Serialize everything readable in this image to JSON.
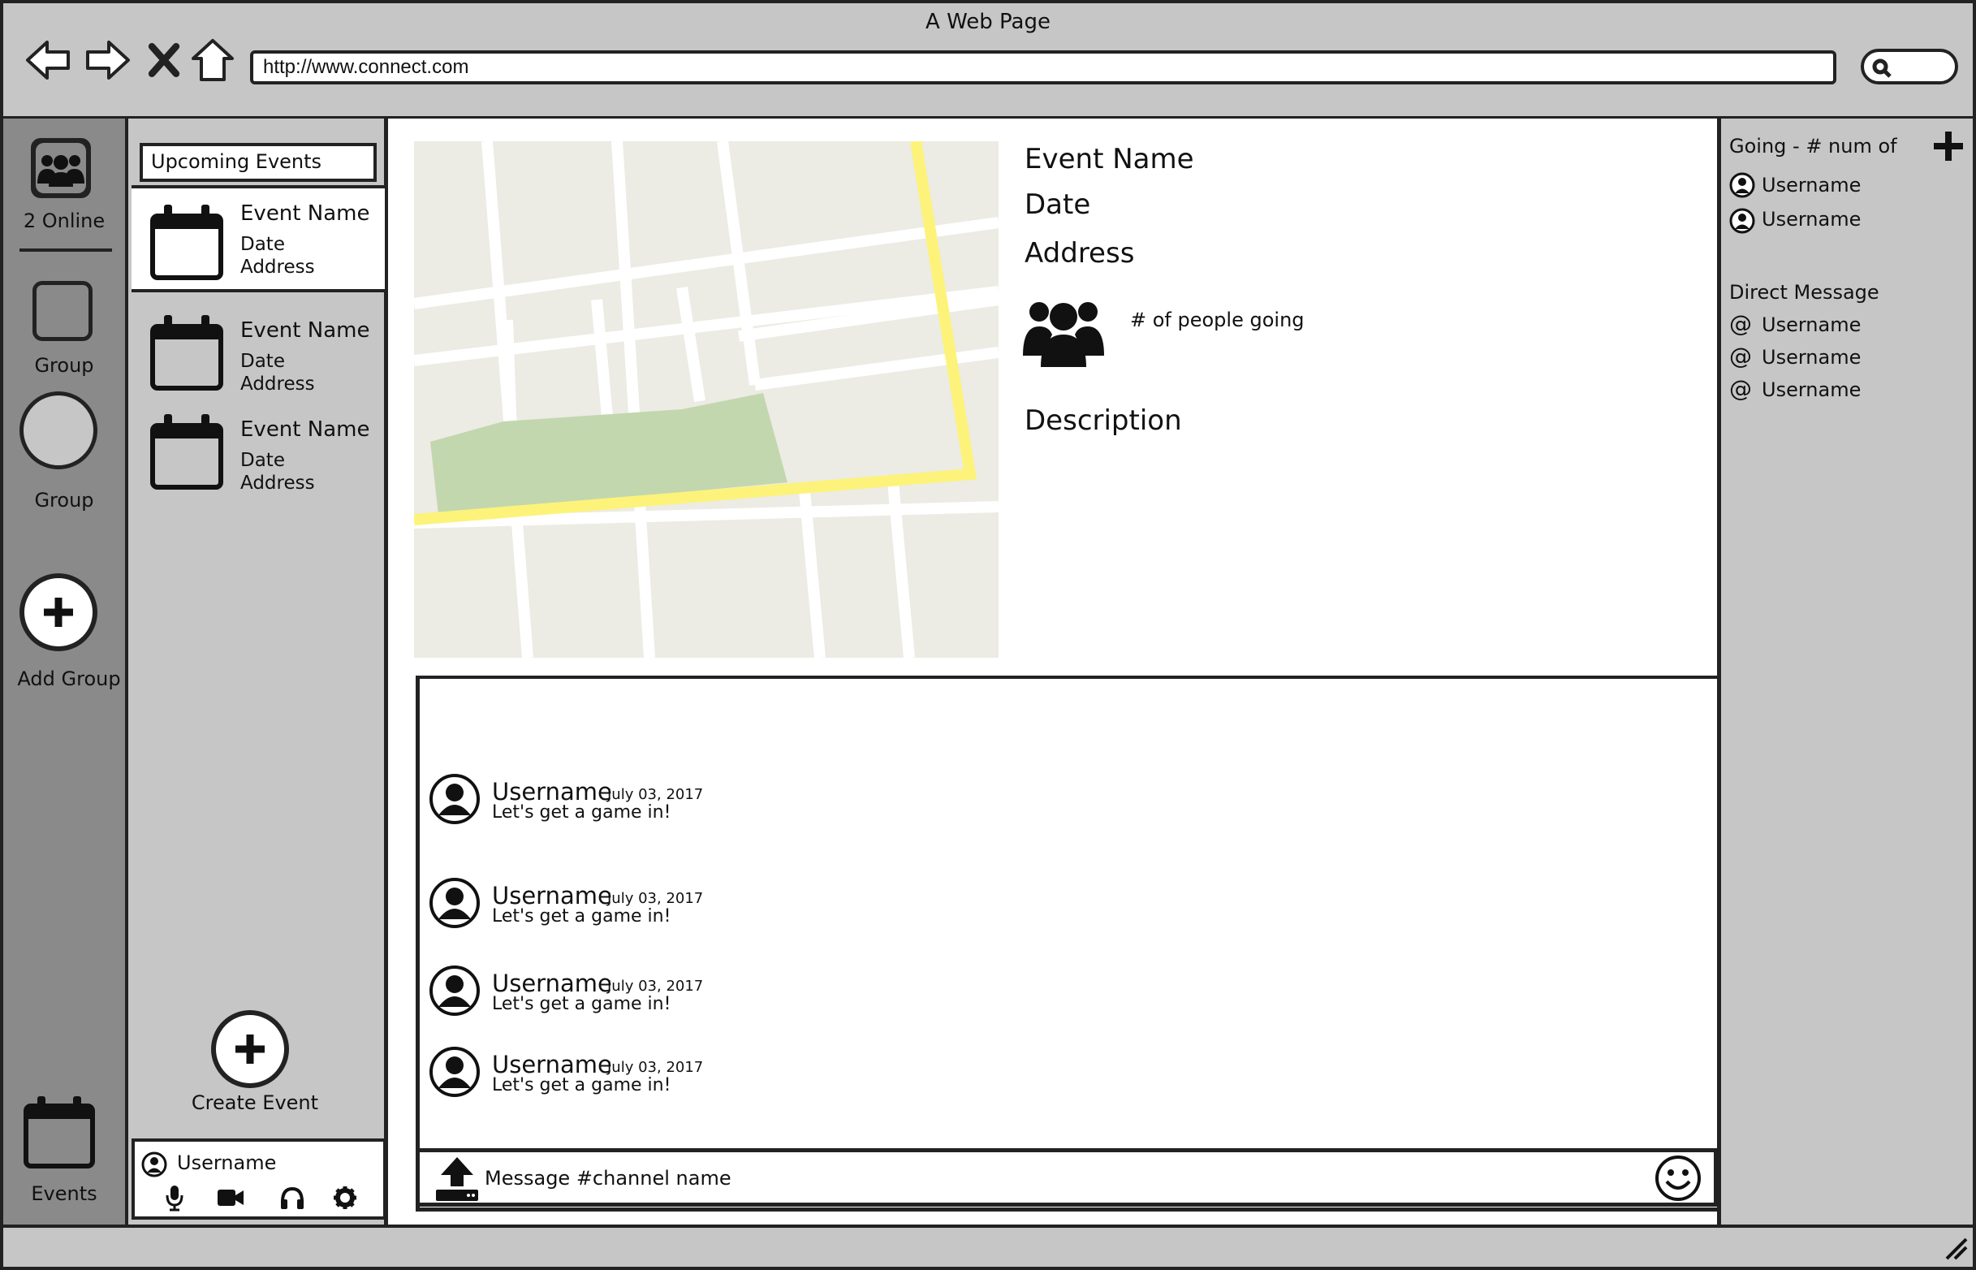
{
  "window": {
    "title": "A Web Page",
    "url": "http://www.connect.com"
  },
  "rail": {
    "online_label": "2 Online",
    "groups": [
      "Group",
      "Group"
    ],
    "add_group_label": "Add Group",
    "events_label": "Events"
  },
  "events_panel": {
    "header": "Upcoming Events",
    "events": [
      {
        "name": "Event Name",
        "date": "Date",
        "address": "Address"
      },
      {
        "name": "Event Name",
        "date": "Date",
        "address": "Address"
      },
      {
        "name": "Event Name",
        "date": "Date",
        "address": "Address"
      }
    ],
    "create_label": "Create Event",
    "username": "Username"
  },
  "detail": {
    "name": "Event Name",
    "date": "Date",
    "address": "Address",
    "people_going": "# of people going",
    "description": "Description"
  },
  "chat": {
    "messages": [
      {
        "user": "Username",
        "date": "July 03, 2017",
        "text": "Let's get a game in!"
      },
      {
        "user": "Username",
        "date": "July 03, 2017",
        "text": "Let's get a game in!"
      },
      {
        "user": "Username",
        "date": "July 03, 2017",
        "text": "Let's get a game in!"
      },
      {
        "user": "Username",
        "date": "July 03, 2017",
        "text": "Let's get a game in!"
      }
    ],
    "input_placeholder": "Message #channel name"
  },
  "right_panel": {
    "going_header": "Going - # num of",
    "going": [
      "Username",
      "Username"
    ],
    "dm_header": "Direct Message",
    "dms": [
      "Username",
      "Username",
      "Username"
    ],
    "at_symbol": "@"
  },
  "colors": {
    "map_bg": "#ecebe4",
    "map_road_major": "#fdf37a",
    "map_park": "#c3d7af",
    "rail_bg": "#8a8a8a",
    "panel_bg": "#c6c6c6"
  }
}
